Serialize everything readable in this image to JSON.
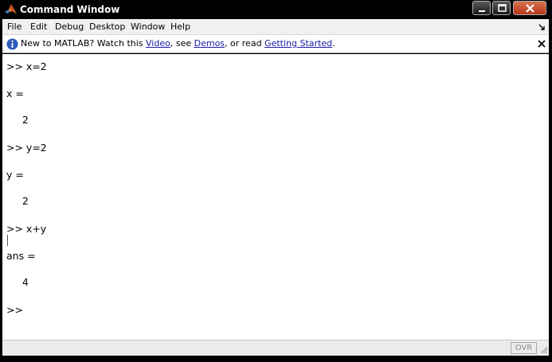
{
  "window": {
    "title": "Command Window",
    "icon": "matlab-logo-icon"
  },
  "menu": {
    "items": [
      "File",
      "Edit",
      "Debug",
      "Desktop",
      "Window",
      "Help"
    ],
    "undock_icon": "undock-arrow-icon"
  },
  "infobar": {
    "icon": "info-icon",
    "prefix": "New to MATLAB? Watch this ",
    "link_video": "Video",
    "sep1": ", see ",
    "link_demos": "Demos",
    "sep2": ", or read ",
    "link_getting_started": "Getting Started",
    "suffix": ".",
    "close_icon": "close-icon"
  },
  "console": {
    "lines": [
      ">> x=2",
      "x =",
      "     2",
      ">> y=2",
      "y =",
      "     2",
      ">> x+y",
      "ans =",
      "     4",
      ">>"
    ]
  },
  "status": {
    "ovr_label": "OVR"
  },
  "colors": {
    "link": "#1a1aa8",
    "title_bar": "#000000",
    "close_button": "#c4462a"
  }
}
